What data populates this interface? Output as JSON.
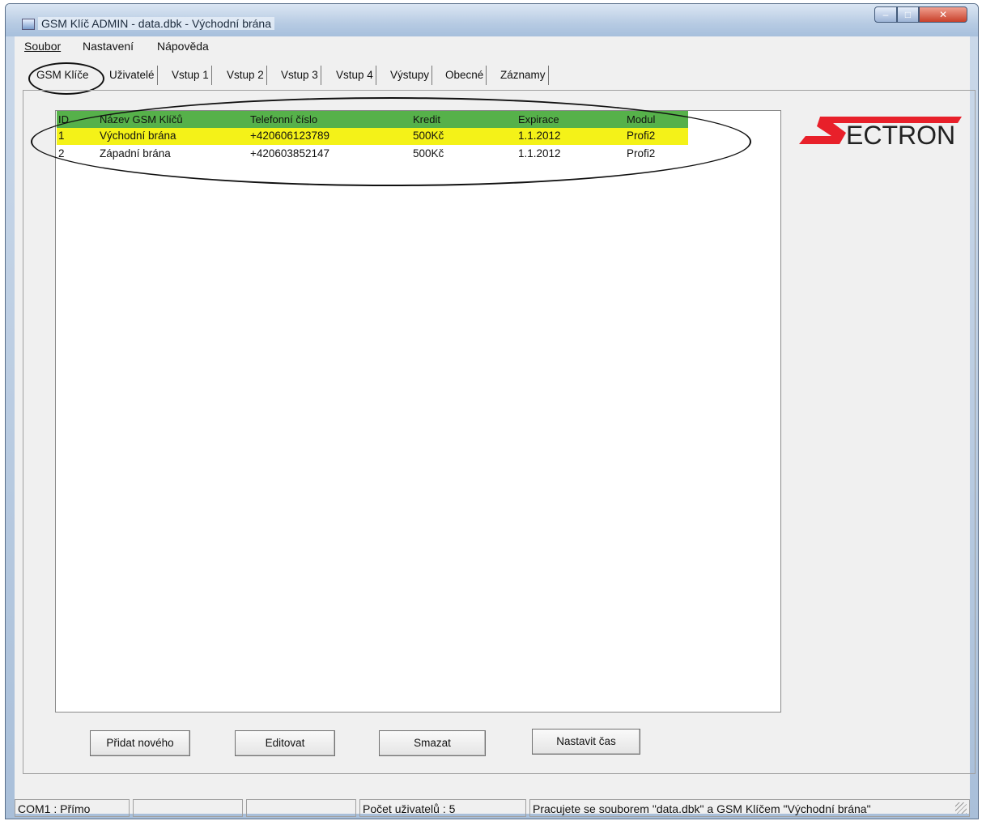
{
  "window": {
    "title": "GSM Klíč ADMIN - data.dbk - Východní brána"
  },
  "menu": [
    "Soubor",
    "Nastavení",
    "Nápověda"
  ],
  "tabs": [
    "GSM Klíče",
    "Uživatelé",
    "Vstup 1",
    "Vstup 2",
    "Vstup 3",
    "Vstup 4",
    "Výstupy",
    "Obecné",
    "Záznamy"
  ],
  "table": {
    "columns": [
      "ID",
      "Název GSM Klíčů",
      "Telefonní číslo",
      "Kredit",
      "Expirace",
      "Modul"
    ],
    "rows": [
      [
        "1",
        "Východní brána",
        "+420606123789",
        "500Kč",
        "1.1.2012",
        "Profi2"
      ],
      [
        "2",
        "Západní brána",
        "+420603852147",
        "500Kč",
        "1.1.2012",
        "Profi2"
      ]
    ]
  },
  "logo": {
    "text": "ECTRON",
    "accent_color": "#e8202a"
  },
  "buttons": [
    "Přidat nového",
    "Editovat",
    "Smazat",
    "Nastavit čas"
  ],
  "status": {
    "port": "COM1 : Přímo",
    "users": "Počet uživatelů : 5",
    "message": "Pracujete se souborem \"data.dbk\" a GSM Klíčem \"Východní brána\""
  },
  "colors": {
    "header_bg": "#56b14a",
    "selected_row_bg": "#f4f218"
  }
}
